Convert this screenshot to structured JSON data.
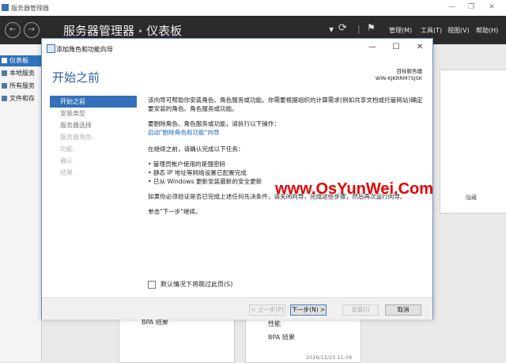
{
  "outer": {
    "title": "服务器管理器",
    "breadcrumb_app": "服务器管理器",
    "breadcrumb_sep": "•",
    "breadcrumb_page": "仪表板",
    "menus": [
      "管理(M)",
      "工具(T)",
      "视图(V)",
      "帮助(H)"
    ],
    "nav": [
      "仪表板",
      "本地服务",
      "所有服务",
      "文件和存"
    ],
    "cards": {
      "left_bpa": "BPA 结果",
      "right_perf": "性能",
      "right_bpa": "BPA 结果",
      "timestamp": "2016/12/21 11:04",
      "hide": "隐藏"
    }
  },
  "wizard": {
    "title": "添加角色和功能向导",
    "heading": "开始之前",
    "server_label": "目标服务器",
    "server_name": "WIN-KJKRRM7SJSK",
    "steps": [
      {
        "label": "开始之前",
        "state": "active"
      },
      {
        "label": "安装类型",
        "state": "normal"
      },
      {
        "label": "服务器选择",
        "state": "normal"
      },
      {
        "label": "服务器角色",
        "state": "disabled"
      },
      {
        "label": "功能",
        "state": "disabled"
      },
      {
        "label": "确认",
        "state": "disabled"
      },
      {
        "label": "结果",
        "state": "disabled"
      }
    ],
    "content": {
      "p1": "该向导可帮助你安装角色、角色服务或功能。你需要根据组织的计算需求(例如共享文档或托管网站)确定要安装的角色、角色服务或功能。",
      "p2": "要删除角色、角色服务或功能，请执行以下操作：",
      "p2_link": "启动\"删除角色和功能\"向导",
      "p3": "在继续之前，请确认完成以下任务：",
      "tasks": [
        "管理员帐户使用的是强密码",
        "静态 IP 地址等网络设置已配置完成",
        "已从 Windows 更新安装最新的安全更新"
      ],
      "p4": "如果你必须验证是否已完成上述任何先决条件，请关闭向导，完成这些步骤，然后再次运行向导。",
      "p5": "单击\"下一步\"继续。"
    },
    "skip_label": "默认情况下将跳过此页(S)",
    "buttons": {
      "prev": "< 上一步(P)",
      "next": "下一步(N) >",
      "install": "安装(I)",
      "cancel": "取消"
    }
  },
  "watermark": "www.OsYunWei.Com"
}
